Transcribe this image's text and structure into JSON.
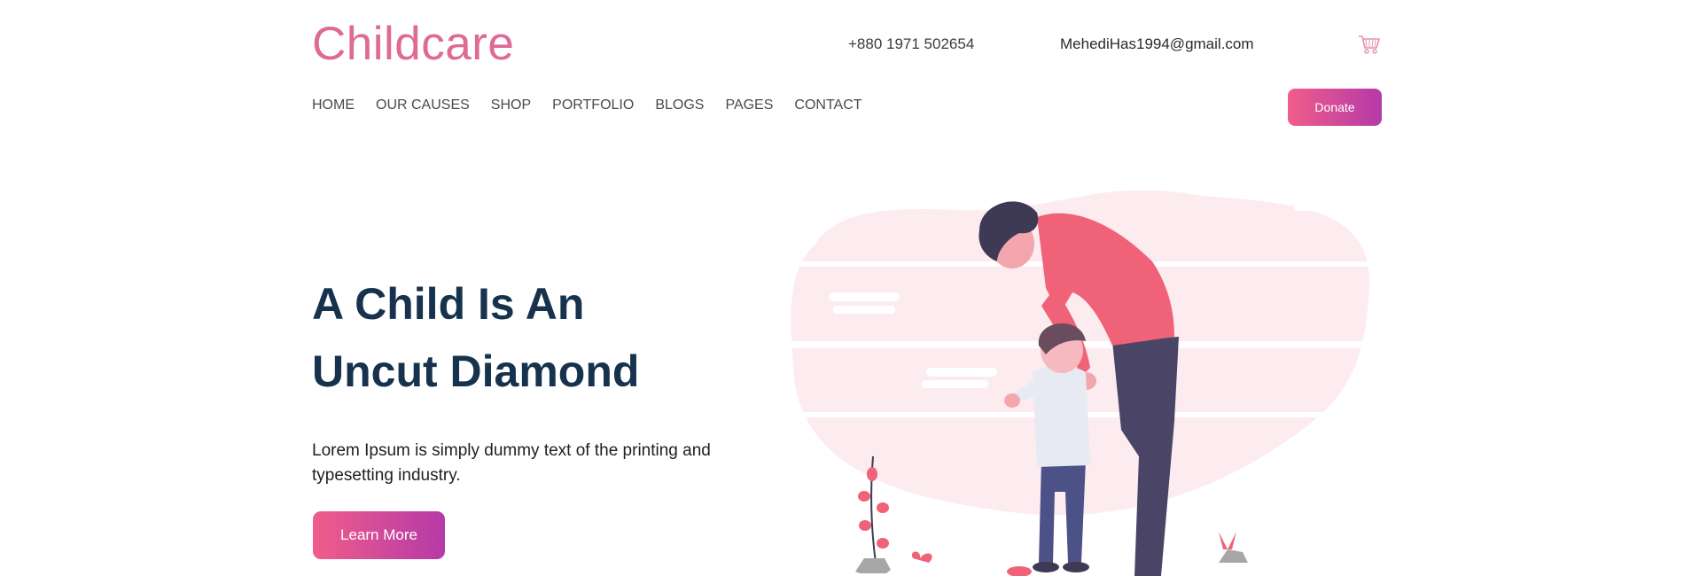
{
  "header": {
    "logo": "Childcare",
    "phone": "+880 1971 502654",
    "email": "MehediHas1994@gmail.com",
    "cart_icon": "cart-icon"
  },
  "nav": {
    "items": [
      {
        "label": "HOME"
      },
      {
        "label": "OUR CAUSES"
      },
      {
        "label": "SHOP"
      },
      {
        "label": "PORTFOLIO"
      },
      {
        "label": "BLOGS"
      },
      {
        "label": "PAGES"
      },
      {
        "label": "CONTACT"
      }
    ],
    "donate_label": "Donate"
  },
  "hero": {
    "title_line1": "A Child Is An",
    "title_line2": "Uncut Diamond",
    "description": "Lorem Ipsum is simply dummy text of the printing and typesetting industry.",
    "cta_label": "Learn More"
  },
  "colors": {
    "brand_pink": "#de6a95",
    "title_navy": "#16324d",
    "gradient_start": "#f05d8a",
    "gradient_end": "#b53aa8"
  }
}
